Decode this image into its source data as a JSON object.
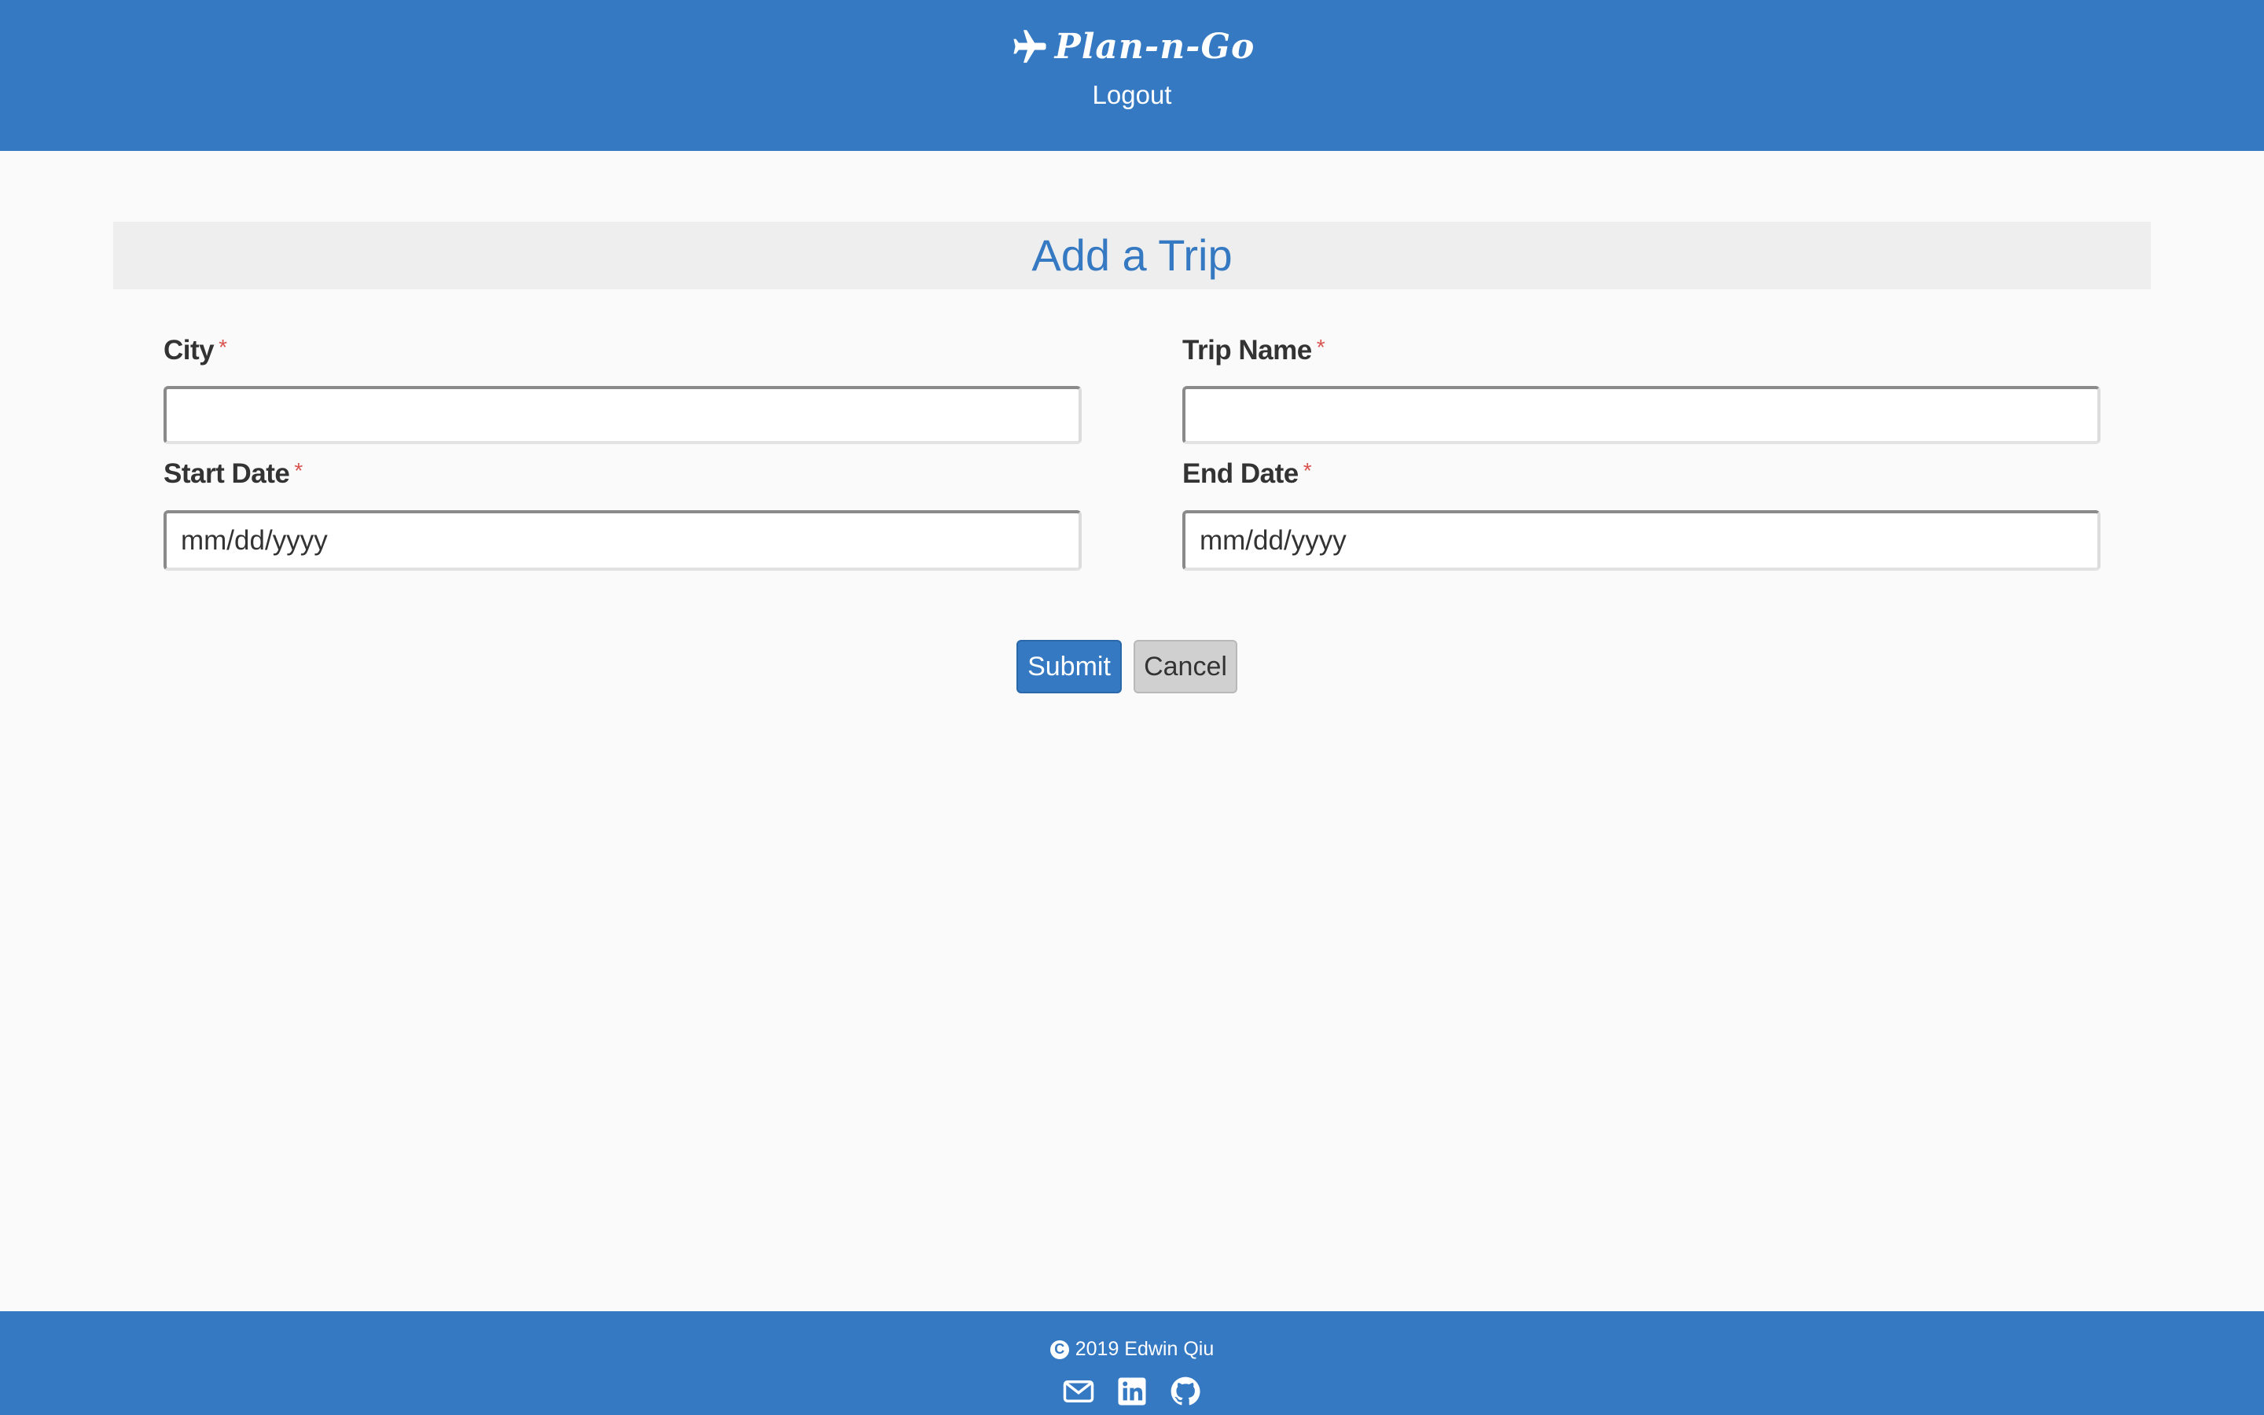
{
  "header": {
    "brand": "Plan-n-Go",
    "brand_icon": "airplane-icon",
    "logout_label": "Logout"
  },
  "form": {
    "title": "Add a Trip",
    "required_marker": "*",
    "fields": {
      "city": {
        "label": "City",
        "value": "",
        "placeholder": ""
      },
      "trip_name": {
        "label": "Trip Name",
        "value": "",
        "placeholder": ""
      },
      "start_date": {
        "label": "Start Date",
        "value": "",
        "placeholder": "mm/dd/yyyy"
      },
      "end_date": {
        "label": "End Date",
        "value": "",
        "placeholder": "mm/dd/yyyy"
      }
    },
    "submit_label": "Submit",
    "cancel_label": "Cancel"
  },
  "footer": {
    "copyright_text": "2019 Edwin Qiu",
    "copyright_icon": "copyright-icon",
    "social_icons": [
      "email-icon",
      "linkedin-icon",
      "github-icon"
    ]
  },
  "colors": {
    "primary": "#3479c2",
    "background": "#fafafa",
    "title_bar": "#eeeeee",
    "required": "#d9534f",
    "cancel_button": "#d0d0d0"
  }
}
